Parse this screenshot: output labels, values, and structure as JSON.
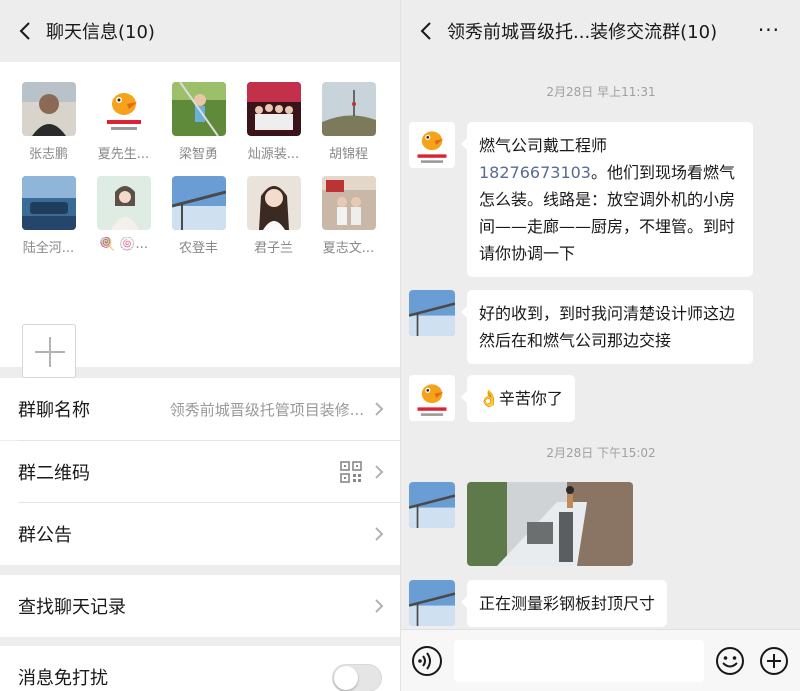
{
  "left": {
    "title": "聊天信息(10)",
    "members": [
      {
        "name": "张志鹏",
        "avatar": "person-icon"
      },
      {
        "name": "夏先生...",
        "avatar": "duck-logo-icon"
      },
      {
        "name": "梁智勇",
        "avatar": "climber-photo-icon"
      },
      {
        "name": "灿源装...",
        "avatar": "group-photo-icon"
      },
      {
        "name": "胡锦程",
        "avatar": "landscape-photo-icon"
      },
      {
        "name": "陆全河...",
        "avatar": "car-photo-icon"
      },
      {
        "name": "🍭 🍥...",
        "avatar": "woman-photo-icon"
      },
      {
        "name": "农登丰",
        "avatar": "crane-photo-icon"
      },
      {
        "name": "君子兰",
        "avatar": "woman-portrait-icon"
      },
      {
        "name": "夏志文...",
        "avatar": "couple-photo-icon"
      }
    ],
    "group_name_label": "群聊名称",
    "group_name_value": "领秀前城晋级托管项目装修...",
    "qr_label": "群二维码",
    "notice_label": "群公告",
    "search_label": "查找聊天记录",
    "mute_label": "消息免打扰",
    "mute_on": false
  },
  "right": {
    "title": "领秀前城晋级托...装修交流群(10)",
    "time1": "2月28日 早上11:31",
    "msg1_line1": "燃气公司戴工程师",
    "msg1_phone": "18276673103",
    "msg1_rest": "。他们到现场看燃气怎么装。线路是：放空调外机的小房间——走廊——厨房，不埋管。到时请你协调一下",
    "msg2": "好的收到，到时我问清楚设计师这边然后在和燃气公司那边交接",
    "msg3_emoji": "👌",
    "msg3": "辛苦你了",
    "time2": "2月28日 下午15:02",
    "msg5": "正在测量彩钢板封顶尺寸"
  },
  "colors": {
    "background": "#ededed",
    "bubble": "#ffffff",
    "link": "#576b95",
    "secondary_text": "#888888"
  }
}
